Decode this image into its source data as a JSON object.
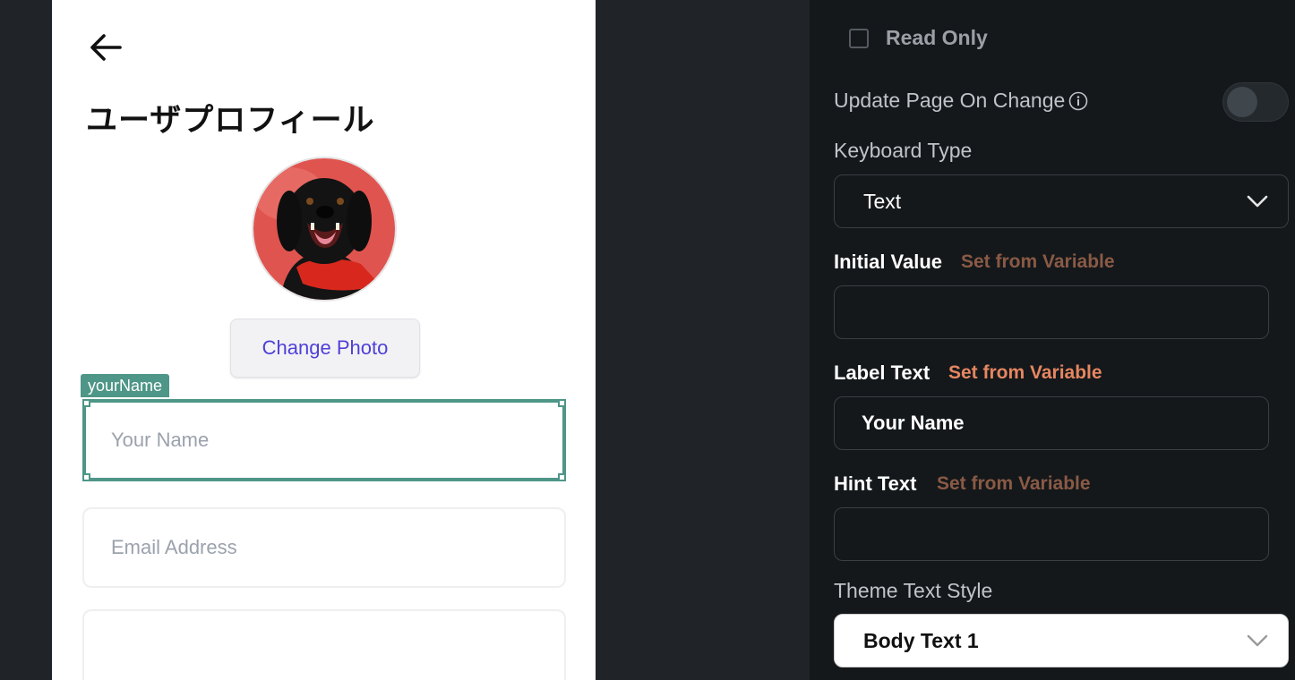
{
  "phone": {
    "page_title": "ユーザプロフィール",
    "change_photo_label": "Change Photo",
    "selected_widget_tag": "yourName",
    "name_placeholder": "Your Name",
    "email_placeholder": "Email Address"
  },
  "panel": {
    "read_only_label": "Read Only",
    "update_page_label": "Update Page On Change",
    "update_page_enabled": false,
    "keyboard_type_label": "Keyboard Type",
    "keyboard_type_value": "Text",
    "initial_value_label": "Initial Value",
    "label_text_label": "Label Text",
    "label_text_value": "Your Name",
    "hint_text_label": "Hint Text",
    "set_from_variable": "Set from Variable",
    "theme_text_style_label": "Theme Text Style",
    "theme_text_style_value": "Body Text 1"
  },
  "colors": {
    "selection_accent": "#4e9687",
    "change_photo_text": "#4f3fd6",
    "variable_link": "#e68660"
  }
}
